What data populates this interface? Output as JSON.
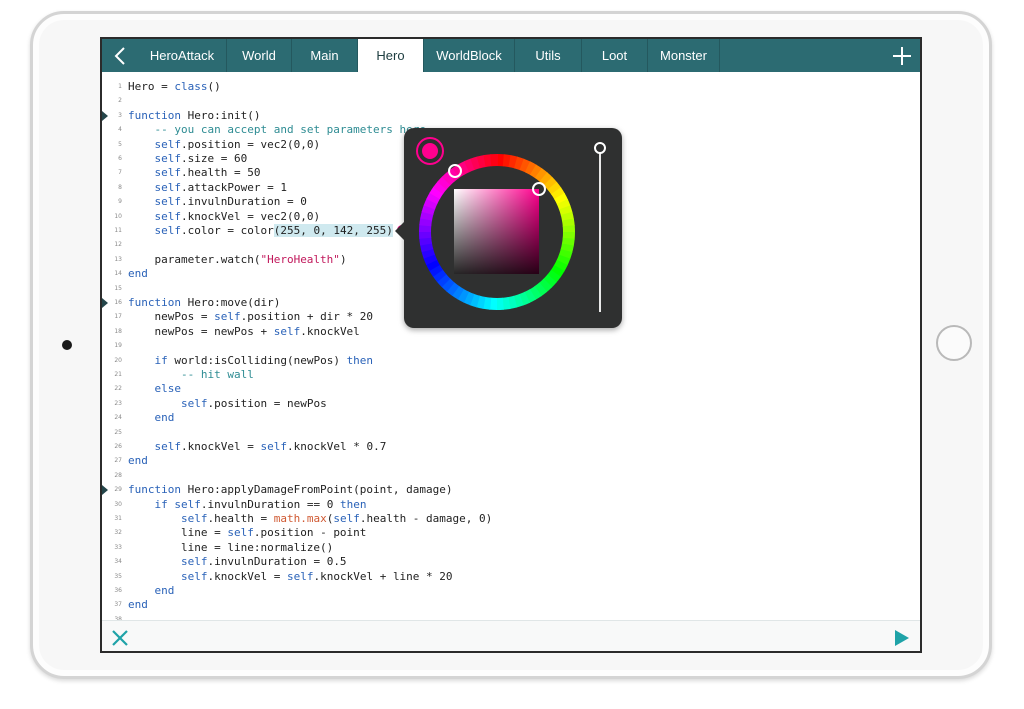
{
  "tabs": [
    {
      "label": "HeroAttack",
      "active": false
    },
    {
      "label": "World",
      "active": false
    },
    {
      "label": "Main",
      "active": false
    },
    {
      "label": "Hero",
      "active": true
    },
    {
      "label": "WorldBlock",
      "active": false
    },
    {
      "label": "Utils",
      "active": false
    },
    {
      "label": "Loot",
      "active": false
    },
    {
      "label": "Monster",
      "active": false
    }
  ],
  "icons": {
    "back": "chevron-left-icon",
    "add": "plus-icon",
    "close": "close-icon",
    "run": "play-icon"
  },
  "colors": {
    "tabbar": "#2c6b72",
    "accent": "#1fa3a8",
    "selected_color": "#ff008e",
    "picker_bg": "#2f3030"
  },
  "color_picker": {
    "selected_rgba": [
      255,
      0,
      142,
      255
    ],
    "hue_degrees": 328,
    "brightness": 1.0
  },
  "code": [
    {
      "n": "1",
      "text": "Hero = class()"
    },
    {
      "n": "2",
      "text": ""
    },
    {
      "n": "3",
      "text": "function Hero:init()",
      "marker": true
    },
    {
      "n": "4",
      "text": "    -- you can accept and set parameters here"
    },
    {
      "n": "5",
      "text": "    self.position = vec2(0,0)"
    },
    {
      "n": "6",
      "text": "    self.size = 60"
    },
    {
      "n": "7",
      "text": "    self.health = 50"
    },
    {
      "n": "8",
      "text": "    self.attackPower = 1"
    },
    {
      "n": "9",
      "text": "    self.invulnDuration = 0"
    },
    {
      "n": "10",
      "text": "    self.knockVel = vec2(0,0)"
    },
    {
      "n": "11",
      "text": "    self.color = color(255, 0, 142, 255)"
    },
    {
      "n": "12",
      "text": ""
    },
    {
      "n": "13",
      "text": "    parameter.watch(\"HeroHealth\")"
    },
    {
      "n": "14",
      "text": "end"
    },
    {
      "n": "15",
      "text": ""
    },
    {
      "n": "16",
      "text": "function Hero:move(dir)",
      "marker": true
    },
    {
      "n": "17",
      "text": "    newPos = self.position + dir * 20"
    },
    {
      "n": "18",
      "text": "    newPos = newPos + self.knockVel"
    },
    {
      "n": "19",
      "text": ""
    },
    {
      "n": "20",
      "text": "    if world:isColliding(newPos) then"
    },
    {
      "n": "21",
      "text": "        -- hit wall"
    },
    {
      "n": "22",
      "text": "    else"
    },
    {
      "n": "23",
      "text": "        self.position = newPos"
    },
    {
      "n": "24",
      "text": "    end"
    },
    {
      "n": "25",
      "text": ""
    },
    {
      "n": "26",
      "text": "    self.knockVel = self.knockVel * 0.7"
    },
    {
      "n": "27",
      "text": "end"
    },
    {
      "n": "28",
      "text": ""
    },
    {
      "n": "29",
      "text": "function Hero:applyDamageFromPoint(point, damage)",
      "marker": true
    },
    {
      "n": "30",
      "text": "    if self.invulnDuration == 0 then"
    },
    {
      "n": "31",
      "text": "        self.health = math.max(self.health - damage, 0)"
    },
    {
      "n": "32",
      "text": "        line = self.position - point"
    },
    {
      "n": "33",
      "text": "        line = line:normalize()"
    },
    {
      "n": "34",
      "text": "        self.invulnDuration = 0.5"
    },
    {
      "n": "35",
      "text": "        self.knockVel = self.knockVel + line * 20"
    },
    {
      "n": "36",
      "text": "    end"
    },
    {
      "n": "37",
      "text": "end"
    },
    {
      "n": "38",
      "text": ""
    }
  ]
}
